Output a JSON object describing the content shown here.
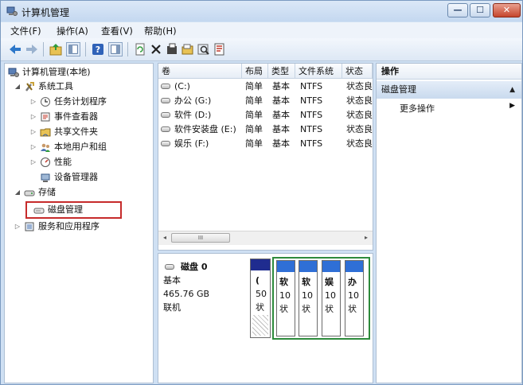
{
  "window": {
    "title": "计算机管理",
    "min_glyph": "—",
    "max_glyph": "☐",
    "close_glyph": "✕"
  },
  "menu": [
    "文件(F)",
    "操作(A)",
    "查看(V)",
    "帮助(H)"
  ],
  "toolbar_icons": [
    "back-icon",
    "forward-icon",
    "up-folder-icon",
    "show-hide-tree-icon",
    "help-icon",
    "properties-icon",
    "refresh-icon",
    "delete-icon",
    "properties-sheet-icon",
    "open-icon",
    "search-icon",
    "export-icon"
  ],
  "tree": {
    "root": "计算机管理(本地)",
    "system_tools": "系统工具",
    "system_items": [
      "任务计划程序",
      "事件查看器",
      "共享文件夹",
      "本地用户和组",
      "性能",
      "设备管理器"
    ],
    "storage": "存储",
    "disk_management": "磁盘管理",
    "services": "服务和应用程序"
  },
  "volumes": {
    "columns": [
      "卷",
      "布局",
      "类型",
      "文件系统",
      "状态"
    ],
    "rows": [
      {
        "name": "(C:)",
        "layout": "简单",
        "type": "基本",
        "fs": "NTFS",
        "status": "状态良"
      },
      {
        "name": "办公 (G:)",
        "layout": "简单",
        "type": "基本",
        "fs": "NTFS",
        "status": "状态良"
      },
      {
        "name": "软件 (D:)",
        "layout": "简单",
        "type": "基本",
        "fs": "NTFS",
        "status": "状态良"
      },
      {
        "name": "软件安装盘 (E:)",
        "layout": "简单",
        "type": "基本",
        "fs": "NTFS",
        "status": "状态良"
      },
      {
        "name": "娱乐 (F:)",
        "layout": "简单",
        "type": "基本",
        "fs": "NTFS",
        "status": "状态良"
      }
    ],
    "scroll_left": "◂",
    "scroll_right": "▸",
    "scroll_thumb": "III"
  },
  "disk": {
    "title": "磁盘 0",
    "type": "基本",
    "size": "465.76 GB",
    "state": "联机",
    "partitions": [
      {
        "l1": "(",
        "l2": "50",
        "l3": "状"
      },
      {
        "l1": "软",
        "l2": "10",
        "l3": "状"
      },
      {
        "l1": "软",
        "l2": "10",
        "l3": "状"
      },
      {
        "l1": "娱",
        "l2": "10",
        "l3": "状"
      },
      {
        "l1": "办",
        "l2": "10",
        "l3": "状"
      }
    ]
  },
  "actions": {
    "header": "操作",
    "section": "磁盘管理",
    "collapse_glyph": "▲",
    "more": "更多操作",
    "more_glyph": "▶"
  },
  "colors": {
    "primary_partition": "#1f2c8f",
    "logical_partition": "#2f6fd6",
    "extended_border": "#2e8b3c",
    "highlight_box": "#c62b2b"
  }
}
